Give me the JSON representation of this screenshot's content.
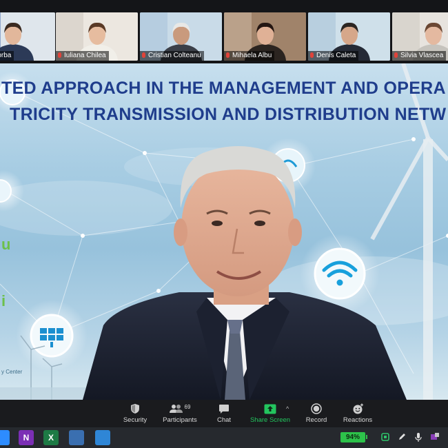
{
  "participants": [
    {
      "name": "L. Csorba",
      "shirt": "#2c3a57",
      "face": "#e2b79b",
      "hair": "#3a2a20",
      "bg1": "#dfe6ec",
      "bg2": "#2f5aa6"
    },
    {
      "name": "Iuliana Chilea",
      "shirt": "#f1efe9",
      "face": "#e6bc9f",
      "hair": "#5a3a26",
      "bg1": "#ece7e0",
      "bg2": "#c9c2b8"
    },
    {
      "name": "Cristian Colteanu",
      "shirt": "#3b3f48",
      "face": "#c99a7d",
      "hair": "#e8e8e6",
      "bg1": "#c9dbe8",
      "bg2": "#9fbcd6"
    },
    {
      "name": "Mihaela Albu",
      "shirt": "#2b2420",
      "face": "#e0b196",
      "hair": "#241612",
      "bg1": "#a0836a",
      "bg2": "#d9c6b2"
    },
    {
      "name": "Denis Caleta",
      "shirt": "#252a36",
      "face": "#d6a78a",
      "hair": "#2c2622",
      "bg1": "#cfe0ea",
      "bg2": "#9bbbd3"
    },
    {
      "name": "Silvia Vlascea",
      "shirt": "#c6c3bd",
      "face": "#e4b9a0",
      "hair": "#6b4733",
      "bg1": "#e7e3de",
      "bg2": "#c8c3bb"
    }
  ],
  "slide": {
    "title_line1": "TED APPROACH IN THE MANAGEMENT AND OPERA",
    "title_line2": "TRICITY TRANSMISSION AND DISTRIBUTION NETW",
    "fragment_chars": [
      "u",
      "i"
    ],
    "footer_text": "y Center"
  },
  "toolbar": {
    "security": "Security",
    "participants": "Participants",
    "participants_count": "69",
    "chat": "Chat",
    "share_screen": "Share Screen",
    "record": "Record",
    "reactions": "Reactions"
  },
  "taskbar": {
    "apps": [
      {
        "icon": "zoom-icon",
        "color": "#2d8cff",
        "letter": ""
      },
      {
        "icon": "onenote-icon",
        "color": "#7b2fb5",
        "letter": "N"
      },
      {
        "icon": "excel-icon",
        "color": "#1d7a45",
        "letter": "X"
      },
      {
        "icon": "network-icon",
        "color": "#3a6fb0",
        "letter": ""
      },
      {
        "icon": "photos-icon",
        "color": "#2f86d6",
        "letter": ""
      }
    ],
    "battery": "94%"
  }
}
